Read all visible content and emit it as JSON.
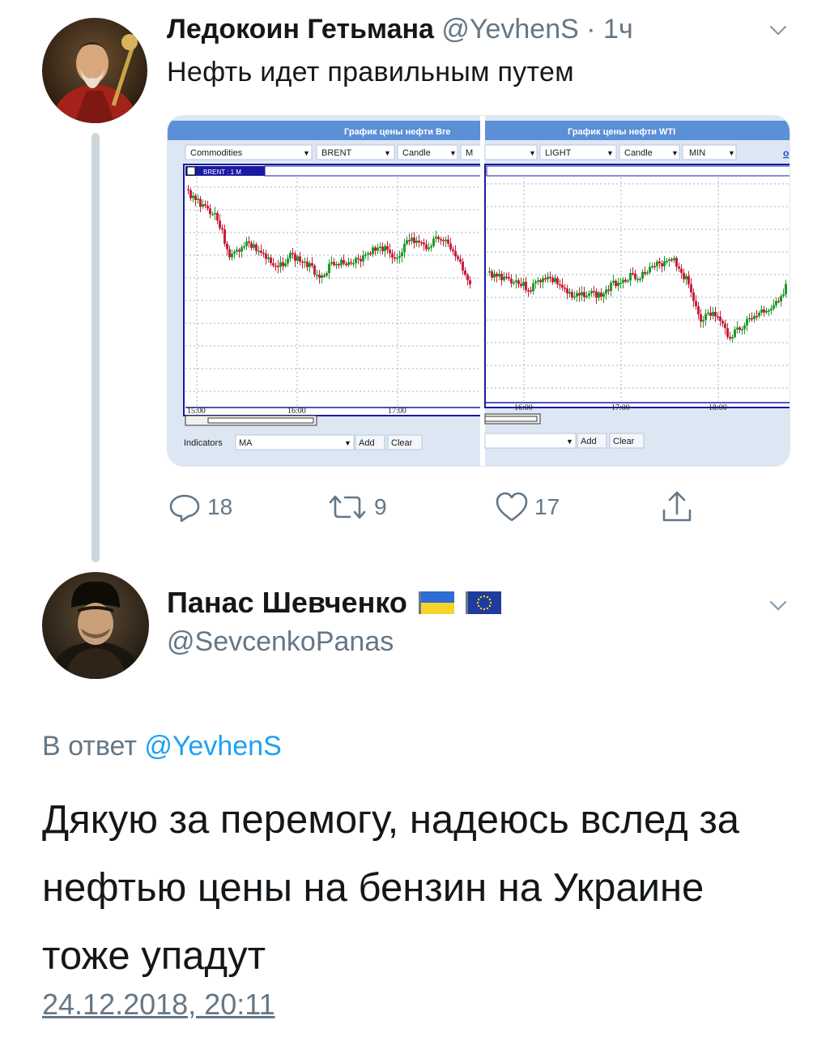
{
  "tweet1": {
    "name": "Ледокоин Гетьмана",
    "handle": "@YevhenS",
    "separator": "·",
    "time": "1ч",
    "text": "Нефть идет правильным путем",
    "media": {
      "left_panel": {
        "title": "График цены нефти Bre",
        "dropdowns": [
          "Commodities",
          "BRENT",
          "Candle",
          "M"
        ],
        "instrument_tag": "BRENT : 1 M",
        "time_ticks": [
          "15:00",
          "16:00",
          "17:00"
        ],
        "indicators_label": "Indicators",
        "indicator_value": "MA",
        "add_label": "Add",
        "clear_label": "Clear"
      },
      "right_panel": {
        "title": "График цены нефти WTI",
        "dropdowns": [
          "LIGHT",
          "Candle",
          "MIN"
        ],
        "link_fragment": "o",
        "time_ticks": [
          "16:00",
          "17:00",
          "18:00"
        ],
        "add_label": "Add",
        "clear_label": "Clear"
      },
      "colors": {
        "up": "#1f9a2a",
        "down": "#c81e3a",
        "frame": "#1a1aa0",
        "header": "#5b8fd6"
      }
    },
    "actions": {
      "reply_icon": "reply-icon",
      "replies": "18",
      "retweet_icon": "retweet-icon",
      "retweets": "9",
      "like_icon": "heart-icon",
      "likes": "17",
      "share_icon": "share-icon"
    }
  },
  "tweet2": {
    "name": "Панас Шевченко",
    "flags": [
      "ukraine-flag",
      "eu-flag"
    ],
    "handle": "@SevcenkoPanas",
    "reply_prefix": "В ответ",
    "reply_mention": "@YevhenS",
    "text": "Дякую за перемогу, надеюсь вслед за нефтью цены на бензин на Украине тоже упадут",
    "timestamp": "24.12.2018, 20:11"
  },
  "theme": {
    "text": "#14171a",
    "secondary": "#657786",
    "link": "#1da1f2",
    "line": "#ccd6dd"
  }
}
